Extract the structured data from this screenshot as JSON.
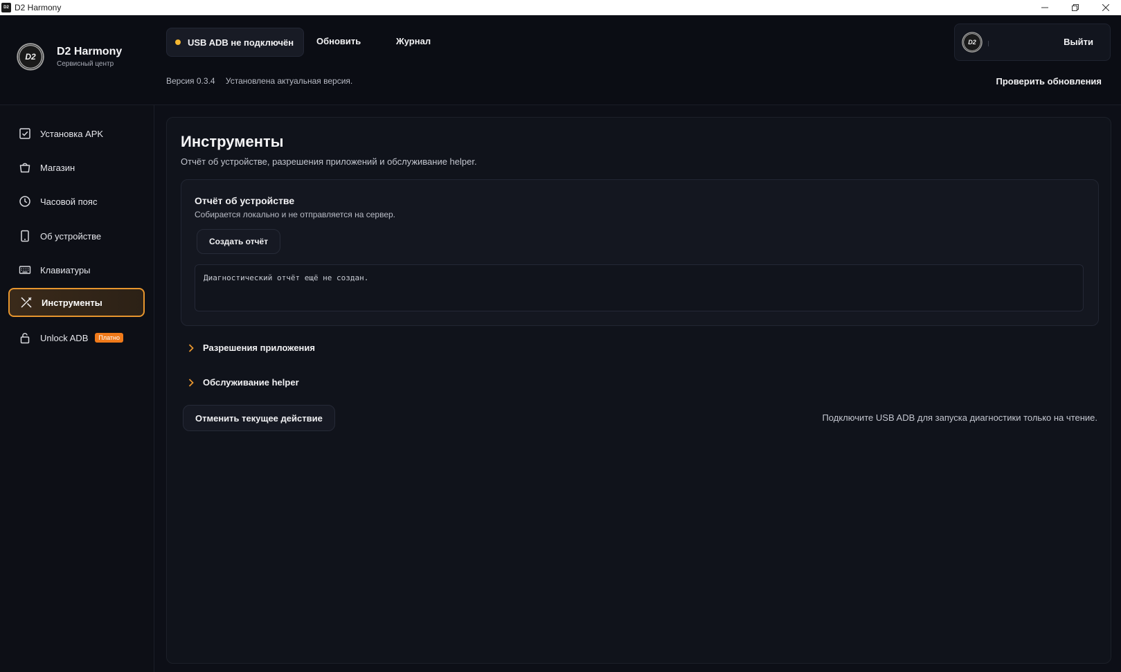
{
  "window": {
    "title": "D2 Harmony",
    "controls": [
      "minimize-icon",
      "restore-icon",
      "close-icon"
    ]
  },
  "brand": {
    "logo_text": "D2",
    "name": "D2 Harmony",
    "subtitle": "Сервисный центр"
  },
  "header": {
    "adb_status": "USB ADB не подключён",
    "adb_status_color": "#f5b731",
    "refresh_label": "Обновить",
    "log_label": "Журнал",
    "version": "Версия 0.3.4",
    "version_status": "Установлена актуальная версия.",
    "avatar_text": "D2",
    "logout_label": "Выйти",
    "check_updates_label": "Проверить обновления"
  },
  "sidebar": {
    "accent": "#e8962e",
    "items": [
      {
        "label": "Установка APK",
        "icon": "checkbox-icon"
      },
      {
        "label": "Магазин",
        "icon": "shopping-bag-icon"
      },
      {
        "label": "Часовой пояс",
        "icon": "clock-icon"
      },
      {
        "label": "Об устройстве",
        "icon": "phone-icon"
      },
      {
        "label": "Клавиатуры",
        "icon": "keyboard-icon"
      },
      {
        "label": "Инструменты",
        "icon": "tools-icon",
        "active": true
      },
      {
        "label": "Unlock ADB",
        "icon": "lock-icon",
        "badge": "Платно"
      }
    ]
  },
  "main": {
    "title": "Инструменты",
    "subtitle": "Отчёт об устройстве, разрешения приложений и обслуживание helper.",
    "report_card": {
      "title": "Отчёт об устройстве",
      "subtitle": "Собирается локально и не отправляется на сервер.",
      "create_label": "Создать отчёт",
      "output": "Диагностический отчёт ещё не создан."
    },
    "sections": [
      {
        "label": "Разрешения приложения"
      },
      {
        "label": "Обслуживание helper"
      }
    ],
    "cancel_label": "Отменить текущее действие",
    "hint": "Подключите USB ADB для запуска диагностики только на чтение."
  }
}
